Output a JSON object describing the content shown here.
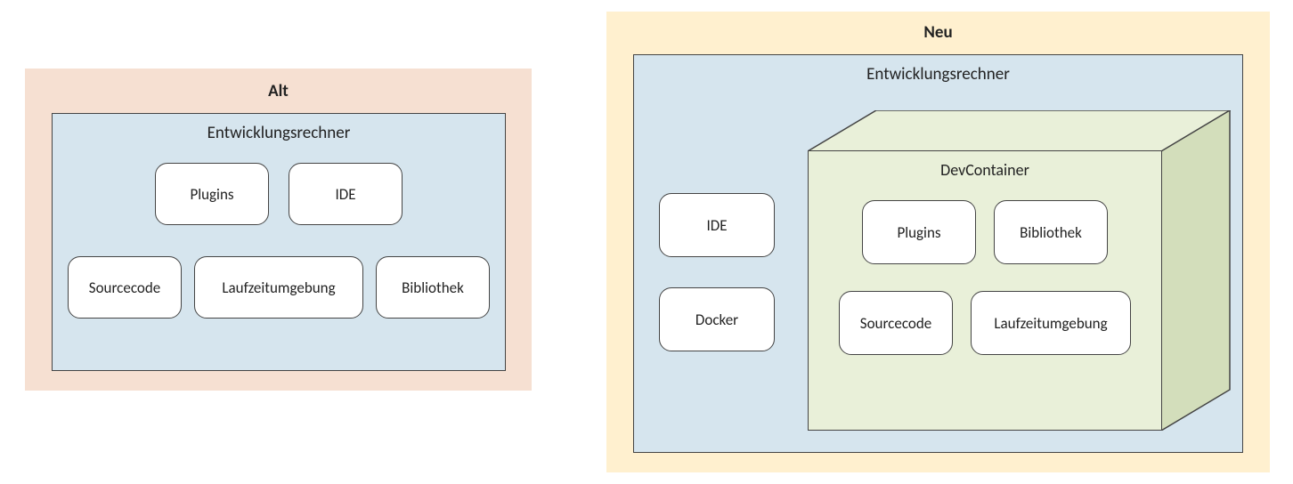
{
  "alt": {
    "title": "Alt",
    "machine_title": "Entwicklungsrechner",
    "boxes": {
      "plugins": "Plugins",
      "ide": "IDE",
      "sourcecode": "Sourcecode",
      "runtime": "Laufzeitumgebung",
      "library": "Bibliothek"
    }
  },
  "neu": {
    "title": "Neu",
    "machine_title": "Entwicklungsrechner",
    "left": {
      "ide": "IDE",
      "docker": "Docker"
    },
    "devcontainer": {
      "title": "DevContainer",
      "boxes": {
        "plugins": "Plugins",
        "library": "Bibliothek",
        "sourcecode": "Sourcecode",
        "runtime": "Laufzeitumgebung"
      }
    }
  }
}
